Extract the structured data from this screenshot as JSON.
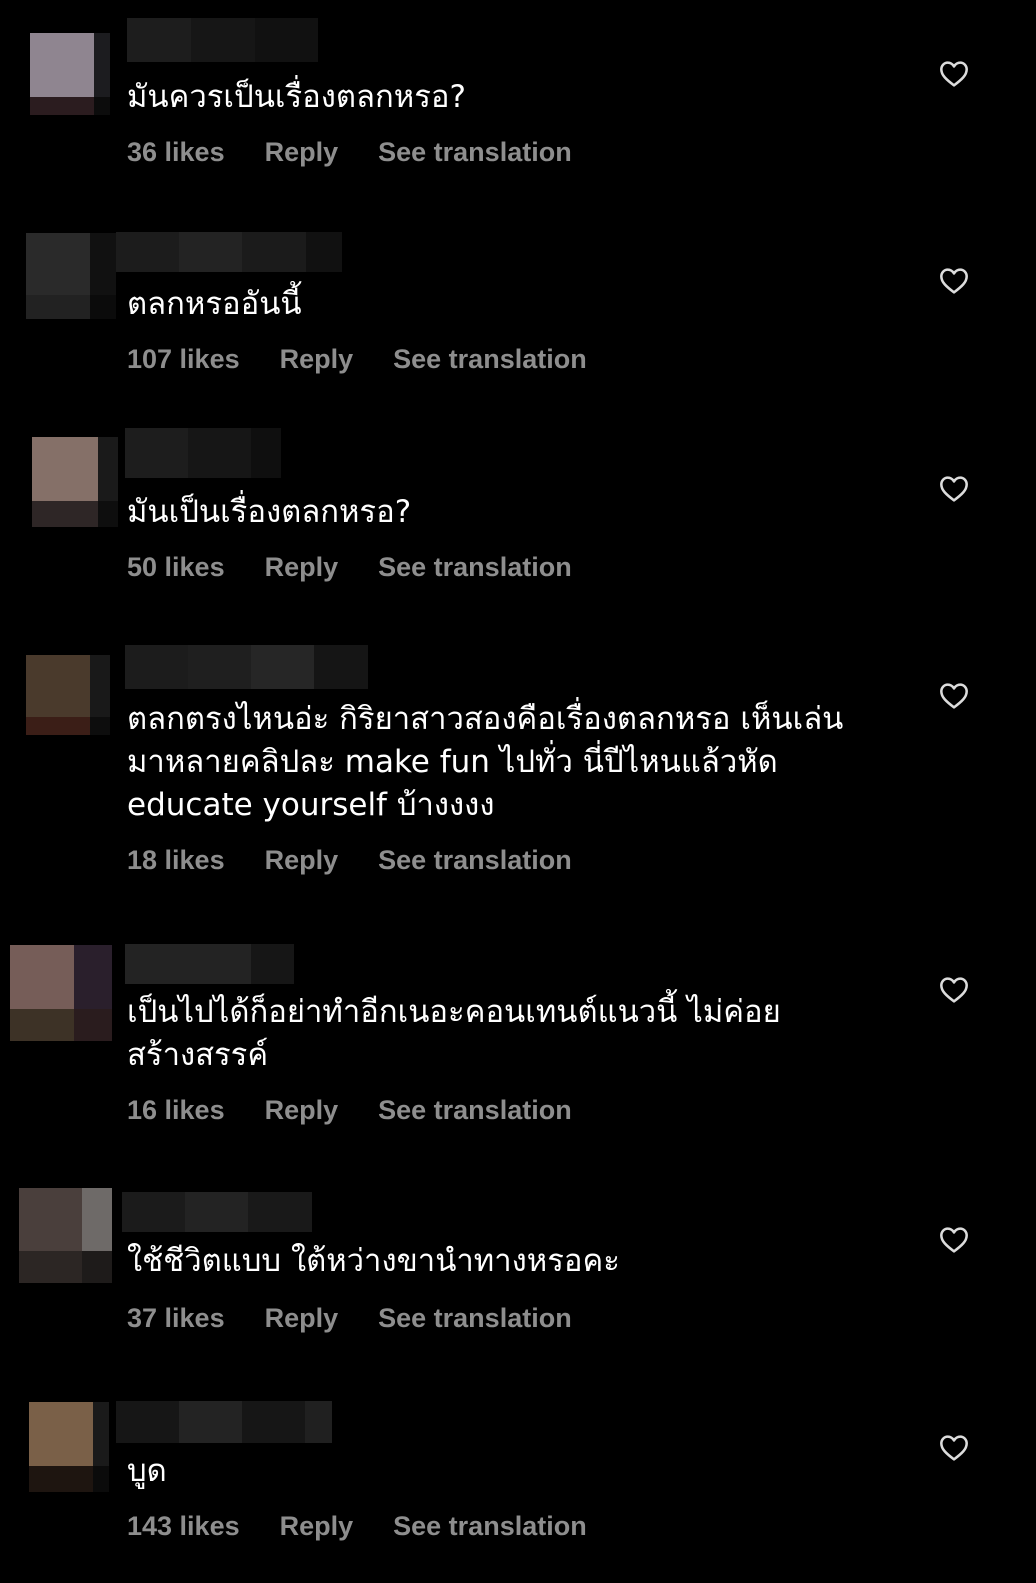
{
  "comments": [
    {
      "text": "มันควรเป็นเรื่องตลกหรอ?",
      "likes": "36 likes",
      "reply": "Reply",
      "see_translation": "See translation"
    },
    {
      "text": "ตลกหรออันนี้",
      "likes": "107 likes",
      "reply": "Reply",
      "see_translation": "See translation"
    },
    {
      "text": "มันเป็นเรื่องตลกหรอ?",
      "likes": "50 likes",
      "reply": "Reply",
      "see_translation": "See translation"
    },
    {
      "text": "ตลกตรงไหนอ่ะ กิริยาสาวสองคือเรื่องตลกหรอ เห็นเล่น\nมาหลายคลิปละ make fun ไปทั่ว นี่ปีไหนแล้วหัด\neducate yourself บ้างงงง",
      "likes": "18 likes",
      "reply": "Reply",
      "see_translation": "See translation"
    },
    {
      "text": "เป็นไปได้ก็อย่าทำอีกเนอะคอนเทนต์แนวนี้ ไม่ค่อย\nสร้างสรรค์",
      "likes": "16 likes",
      "reply": "Reply",
      "see_translation": "See translation"
    },
    {
      "text": "ใช้ชีวิตแบบ ใต้หว่างขานำทางหรอคะ",
      "likes": "37 likes",
      "reply": "Reply",
      "see_translation": "See translation"
    },
    {
      "text": "บูด",
      "likes": "143 likes",
      "reply": "Reply",
      "see_translation": "See translation"
    }
  ],
  "icons": {
    "like": "heart-outline-icon"
  },
  "colors": {
    "background": "#000000",
    "text": "#ffffff",
    "secondary_text": "#8e8e8e"
  }
}
